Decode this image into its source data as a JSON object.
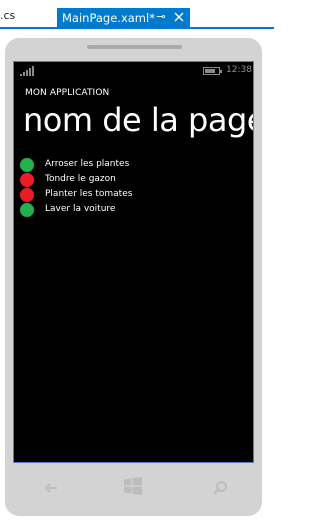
{
  "tabs": {
    "prev_tab_label": ".cs",
    "active_tab_label": "MainPage.xaml*",
    "pin_glyph": "⊸",
    "accent": "#007acc"
  },
  "status_bar": {
    "time": "12:38"
  },
  "app": {
    "application_title": "MON APPLICATION",
    "page_title": "nom de la page"
  },
  "tasks": [
    {
      "label": "Arroser les plantes",
      "status_color": "#22b14c"
    },
    {
      "label": "Tondre le gazon",
      "status_color": "#ed1c24"
    },
    {
      "label": "Planter les tomates",
      "status_color": "#ed1c24"
    },
    {
      "label": "Laver la voiture",
      "status_color": "#22b14c"
    }
  ],
  "icons": {
    "signal": "signal-strength-icon",
    "battery": "battery-icon",
    "back": "back-arrow-icon",
    "start": "windows-start-icon",
    "search": "search-icon",
    "pin": "pin-icon",
    "close": "close-icon"
  }
}
